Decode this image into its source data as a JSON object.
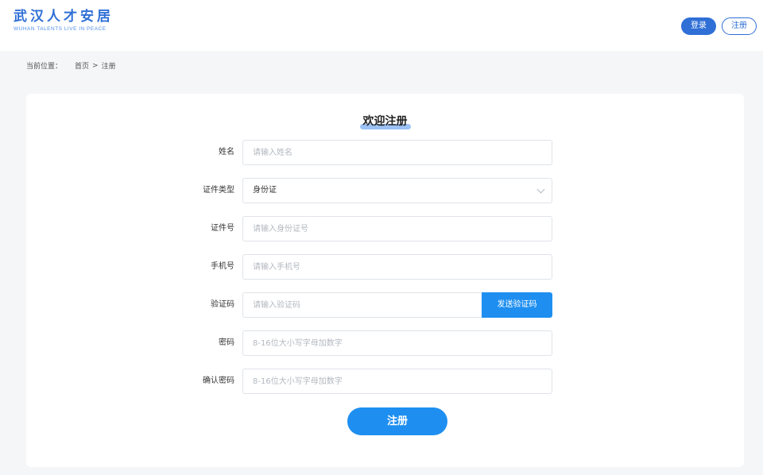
{
  "header": {
    "logo_cn": "武汉人才安居",
    "logo_en": "WUHAN TALENTS LIVE IN PEACE",
    "login_label": "登录",
    "register_label": "注册"
  },
  "breadcrumb": {
    "label": "当前位置：",
    "home": "首页",
    "separator": ">",
    "current": "注册"
  },
  "form": {
    "title": "欢迎注册",
    "fields": [
      {
        "label": "姓名",
        "placeholder": "请输入姓名",
        "value": ""
      },
      {
        "label": "证件类型",
        "value": "身份证",
        "type": "select"
      },
      {
        "label": "证件号",
        "placeholder": "请输入身份证号",
        "value": ""
      },
      {
        "label": "手机号",
        "placeholder": "请输入手机号",
        "value": ""
      },
      {
        "label": "验证码",
        "placeholder": "请输入验证码",
        "value": "",
        "button": "发送验证码"
      },
      {
        "label": "密码",
        "placeholder": "8-16位大小写字母加数字",
        "value": ""
      },
      {
        "label": "确认密码",
        "placeholder": "8-16位大小写字母加数字",
        "value": ""
      }
    ],
    "submit_label": "注册"
  },
  "colors": {
    "brand": "#2f6fd6",
    "accent": "#1e8ff0",
    "title_highlight": "#9cc2f5",
    "page_bg": "#f5f6f8"
  },
  "icons": {
    "select_arrow": "chevron-down-icon"
  }
}
